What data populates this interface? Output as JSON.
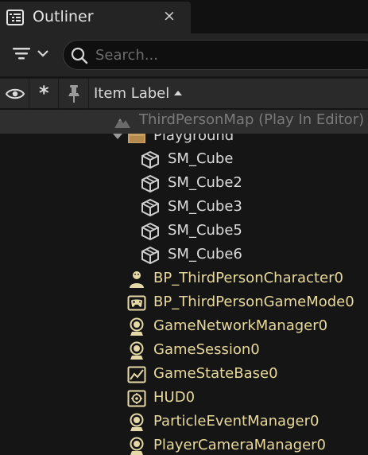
{
  "tab": {
    "title": "Outliner",
    "close_glyph": "×",
    "icon": "outliner-list-icon"
  },
  "toolbar": {
    "filter_icon": "filter-icon",
    "filter_dropdown_icon": "chevron-down-icon",
    "search_placeholder": "Search..."
  },
  "header": {
    "visibility_icon": "eye-icon",
    "favorite_glyph": "*",
    "pin_icon": "pin-icon",
    "item_label": "Item Label",
    "sort": "ascending"
  },
  "world": {
    "label": "ThirdPersonMap (Play In Editor)",
    "icon": "world-map-icon"
  },
  "folder": {
    "label": "Playground",
    "icon": "folder-icon",
    "expanded": true
  },
  "meshes": [
    {
      "label": "SM_Cube",
      "icon": "static-mesh-icon"
    },
    {
      "label": "SM_Cube2",
      "icon": "static-mesh-icon"
    },
    {
      "label": "SM_Cube3",
      "icon": "static-mesh-icon"
    },
    {
      "label": "SM_Cube5",
      "icon": "static-mesh-icon"
    },
    {
      "label": "SM_Cube6",
      "icon": "static-mesh-icon"
    }
  ],
  "actors": [
    {
      "label": "BP_ThirdPersonCharacter0",
      "icon": "character-icon"
    },
    {
      "label": "BP_ThirdPersonGameMode0",
      "icon": "gamemode-icon"
    },
    {
      "label": "GameNetworkManager0",
      "icon": "actor-icon"
    },
    {
      "label": "GameSession0",
      "icon": "actor-icon"
    },
    {
      "label": "GameStateBase0",
      "icon": "gamestate-icon"
    },
    {
      "label": "HUD0",
      "icon": "hud-icon"
    },
    {
      "label": "ParticleEventManager0",
      "icon": "actor-icon"
    },
    {
      "label": "PlayerCameraManager0",
      "icon": "actor-icon"
    }
  ],
  "colors": {
    "actor_label": "#e8d99c",
    "mesh_label": "#dcdcdc",
    "world_label": "#7a7a7a",
    "background": "#151515"
  }
}
